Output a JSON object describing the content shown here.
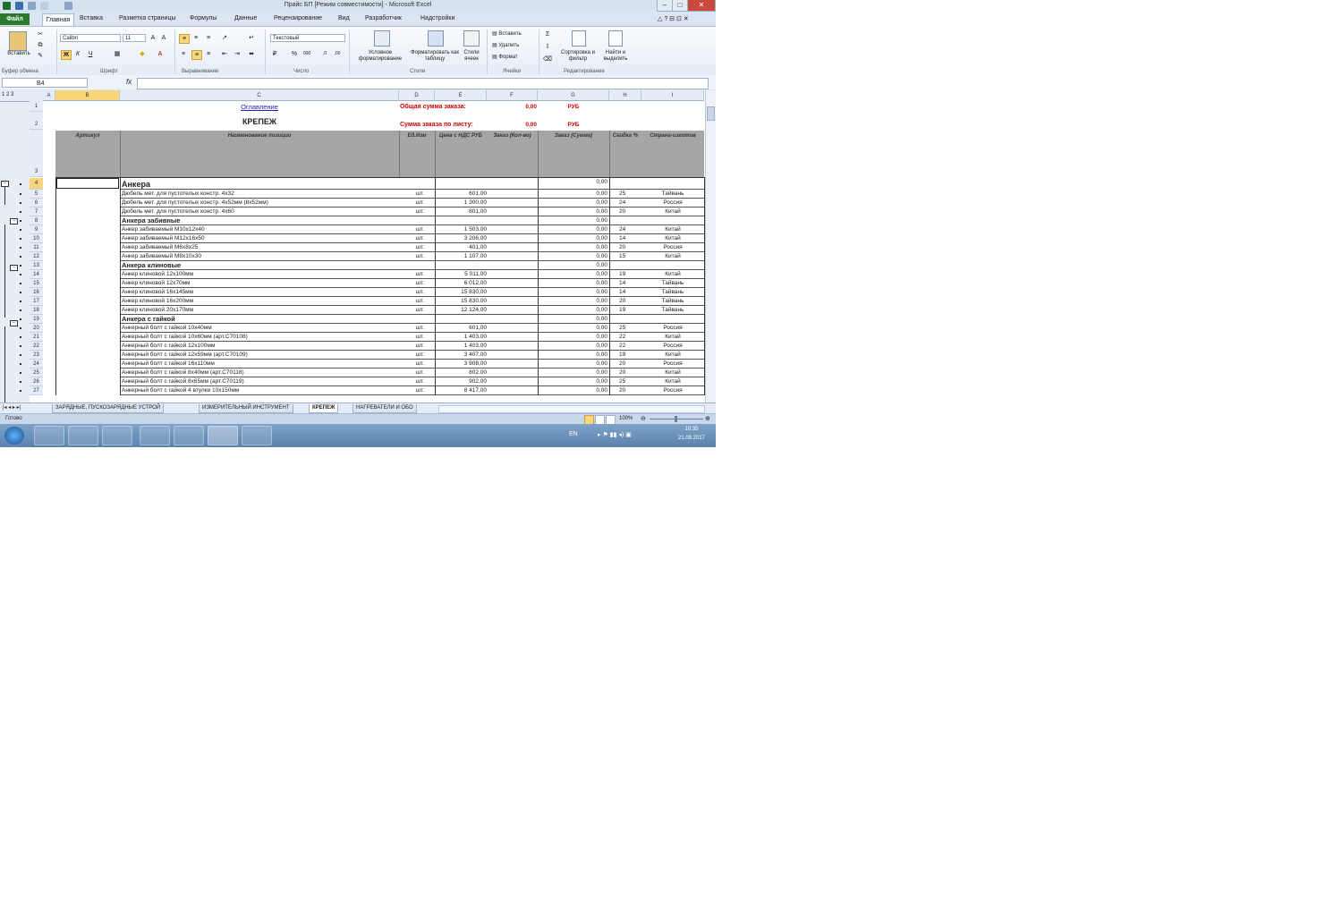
{
  "window": {
    "title": "Прайс БП [Режим совместимости] - Microsoft Excel"
  },
  "ribbon_tabs": [
    "Файл",
    "Главная",
    "Вставка",
    "Разметка страницы",
    "Формулы",
    "Данные",
    "Рецензирование",
    "Вид",
    "Разработчик",
    "Надстройки"
  ],
  "ribbon": {
    "paste_label": "Вставить",
    "font_name": "Calibri",
    "font_size": "11",
    "number_format": "Текстовый",
    "cond_format": "Условное форматирование",
    "format_table": "Форматировать как таблицу",
    "cell_styles": "Стили ячеек",
    "insert": "Вставить",
    "delete": "Удалить",
    "format": "Формат",
    "sort_filter": "Сортировка и фильтр",
    "find_select": "Найти и выделить",
    "groups": [
      "Буфер обмена",
      "Шрифт",
      "Выравнивание",
      "Число",
      "Стили",
      "Ячейки",
      "Редактирование"
    ]
  },
  "formula_bar": {
    "name_box": "B4",
    "fx": "fx",
    "value": ""
  },
  "columns": [
    "A",
    "B",
    "C",
    "D",
    "E",
    "F",
    "G",
    "H",
    "I"
  ],
  "sheet": {
    "link_toc": "Оглавление",
    "title": "КРЕПЕЖ",
    "total_label": "Общая сумма заказа:",
    "total_value": "0,00",
    "total_cur": "РУБ",
    "sheet_label": "Сумма заказа по листу:",
    "sheet_value": "0,00",
    "sheet_cur": "РУБ",
    "headers": {
      "article": "Артикул",
      "name": "Наименование позиции",
      "unit": "Ед.Изм",
      "price": "Цена с НДС РУБ",
      "order_qty": "Заказ (Кол-во)",
      "order_sum": "Заказ (Сумма)",
      "discount": "Скидка %",
      "country": "Страна-изготов"
    },
    "rows": [
      {
        "n": "4",
        "group": "Анкера",
        "sum": "0,00",
        "big": true
      },
      {
        "n": "5",
        "name": "Дюбель мет. для пустотелых констр. 4х32",
        "unit": "шт.",
        "price": "601,00",
        "sum": "0,00",
        "disc": "25",
        "country": "Тайвань"
      },
      {
        "n": "6",
        "name": "Дюбель мет. для пустотелых констр. 4х52мм (8х52мм)",
        "unit": "шт.",
        "price": "1 300,00",
        "sum": "0,00",
        "disc": "24",
        "country": "Россия"
      },
      {
        "n": "7",
        "name": "Дюбель мет. для пустотелых констр. 4х60",
        "unit": "шт.",
        "price": "801,00",
        "sum": "0,00",
        "disc": "20",
        "country": "Китай"
      },
      {
        "n": "8",
        "group": "Анкера забивные",
        "sum": "0,00"
      },
      {
        "n": "9",
        "name": "Анкер забиваемый  М10х12х40",
        "unit": "шт.",
        "price": "1 503,00",
        "sum": "0,00",
        "disc": "24",
        "country": "Китай"
      },
      {
        "n": "10",
        "name": "Анкер забиваемый  М12х16х50",
        "unit": "шт.",
        "price": "3 206,00",
        "sum": "0,00",
        "disc": "14",
        "country": "Китай"
      },
      {
        "n": "11",
        "name": "Анкер забиваемый  М6х8х25",
        "unit": "шт.",
        "price": "401,00",
        "sum": "0,00",
        "disc": "20",
        "country": "Россия"
      },
      {
        "n": "12",
        "name": "Анкер забиваемый  М8х10х30",
        "unit": "шт.",
        "price": "1 107,00",
        "sum": "0,00",
        "disc": "15",
        "country": "Китай"
      },
      {
        "n": "13",
        "group": "Анкера клиновые",
        "sum": "0,00"
      },
      {
        "n": "14",
        "name": "Анкер клиновой 12х100мм",
        "unit": "шт.",
        "price": "5 011,00",
        "sum": "0,00",
        "disc": "19",
        "country": "Китай"
      },
      {
        "n": "15",
        "name": "Анкер клиновой 12х70мм",
        "unit": "шт.",
        "price": "6 012,00",
        "sum": "0,00",
        "disc": "14",
        "country": "Тайвань"
      },
      {
        "n": "16",
        "name": "Анкер клиновой 16х145мм",
        "unit": "шт.",
        "price": "15 830,00",
        "sum": "0,00",
        "disc": "14",
        "country": "Тайвань"
      },
      {
        "n": "17",
        "name": "Анкер клиновой 16х200мм",
        "unit": "шт.",
        "price": "15 830,00",
        "sum": "0,00",
        "disc": "20",
        "country": "Тайвань"
      },
      {
        "n": "18",
        "name": "Анкер клиновой 20х170мм",
        "unit": "шт.",
        "price": "12 124,00",
        "sum": "0,00",
        "disc": "19",
        "country": "Тайвань"
      },
      {
        "n": "19",
        "group": "Анкера с гайкой",
        "sum": "0,00"
      },
      {
        "n": "20",
        "name": "Анкерный болт с гайкой 10х40мм",
        "unit": "шт.",
        "price": "601,00",
        "sum": "0,00",
        "disc": "25",
        "country": "Россия"
      },
      {
        "n": "21",
        "name": "Анкерный болт с гайкой 10х60мм (арт.C70108)",
        "unit": "шт.",
        "price": "1 403,00",
        "sum": "0,00",
        "disc": "22",
        "country": "Китай"
      },
      {
        "n": "22",
        "name": "Анкерный болт с гайкой 12х100мм",
        "unit": "шт.",
        "price": "1 403,00",
        "sum": "0,00",
        "disc": "22",
        "country": "Россия"
      },
      {
        "n": "23",
        "name": "Анкерный болт с гайкой 12х59мм (арт.C70109)",
        "unit": "шт.",
        "price": "3 407,00",
        "sum": "0,00",
        "disc": "19",
        "country": "Китай"
      },
      {
        "n": "24",
        "name": "Анкерный болт с гайкой 16х110мм",
        "unit": "шт.",
        "price": "3 908,00",
        "sum": "0,00",
        "disc": "20",
        "country": "Россия"
      },
      {
        "n": "25",
        "name": "Анкерный болт с гайкой 8х40мм (арт.C70118)",
        "unit": "шт.",
        "price": "802,00",
        "sum": "0,00",
        "disc": "20",
        "country": "Китай"
      },
      {
        "n": "26",
        "name": "Анкерный болт с гайкой 8х65мм (арт.C70119)",
        "unit": "шт.",
        "price": "902,00",
        "sum": "0,00",
        "disc": "25",
        "country": "Китай"
      },
      {
        "n": "27",
        "name": "Анкерный болт с гайкой 4 втулки 10х150мм",
        "unit": "шт.",
        "price": "8 417,00",
        "sum": "0,00",
        "disc": "20",
        "country": "Россия"
      }
    ]
  },
  "sheet_tabs": [
    "ЗАРЯДНЫЕ, ПУСКОЗАРЯДНЫЕ УСТРОЙ",
    "ИЗМЕРИТЕЛЬНЫЙ ИНСТРУМЕНТ",
    "КРЕПЕЖ",
    "НАГРЕВАТЕЛИ И ОБО"
  ],
  "status": {
    "mode": "Готово",
    "zoom": "100%"
  },
  "taskbar": {
    "lang": "EN",
    "time": "10:35",
    "date": "21.09.2017"
  },
  "colors": {
    "excel_green": "#2c7a2f",
    "header_gray": "#a6a6a6",
    "red": "#d40000",
    "link": "#1f1fb4"
  }
}
